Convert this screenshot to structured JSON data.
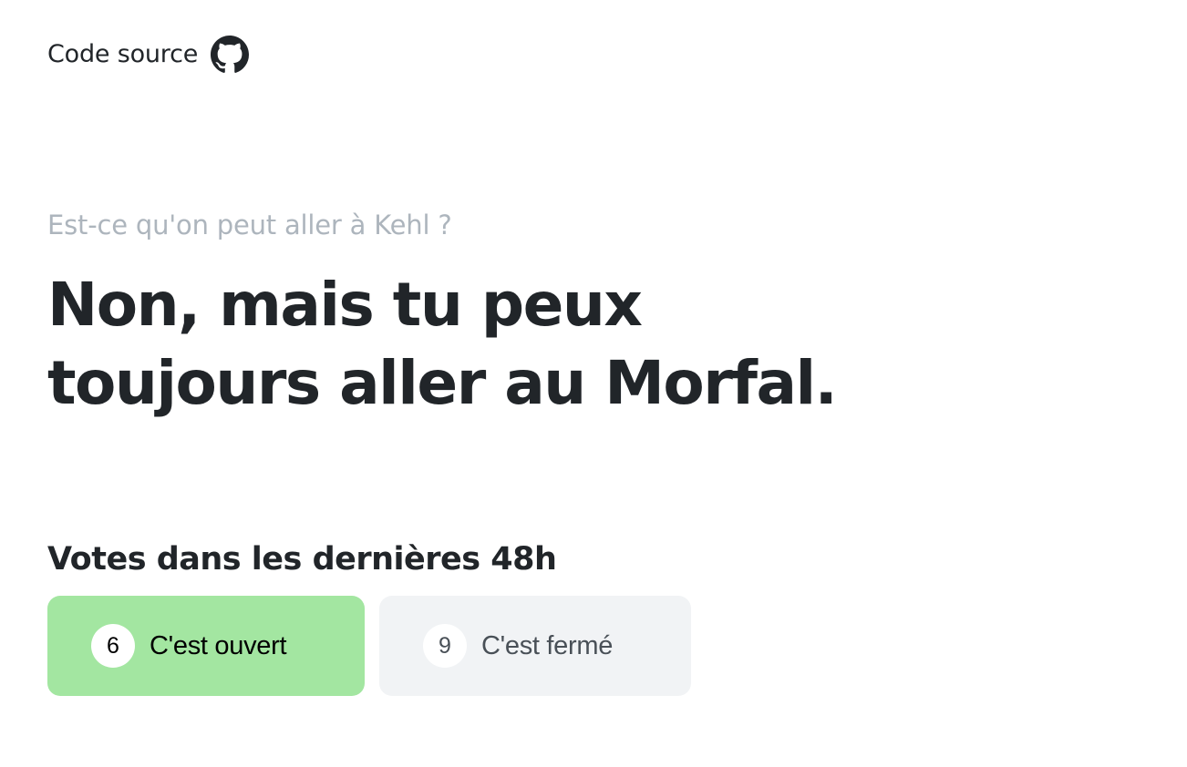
{
  "header": {
    "source_label": "Code source",
    "source_icon": "github-icon"
  },
  "hero": {
    "question": "Est-ce qu'on peut aller à Kehl ?",
    "answer_line1": "Non, mais tu peux",
    "answer_line2": "toujours aller au Morfal."
  },
  "votes": {
    "title": "Votes dans les dernières 48h",
    "open": {
      "count": "6",
      "label": "C'est ouvert",
      "color": "#a3e6a1"
    },
    "closed": {
      "count": "9",
      "label": "C'est fermé",
      "color": "#f1f3f5"
    }
  }
}
